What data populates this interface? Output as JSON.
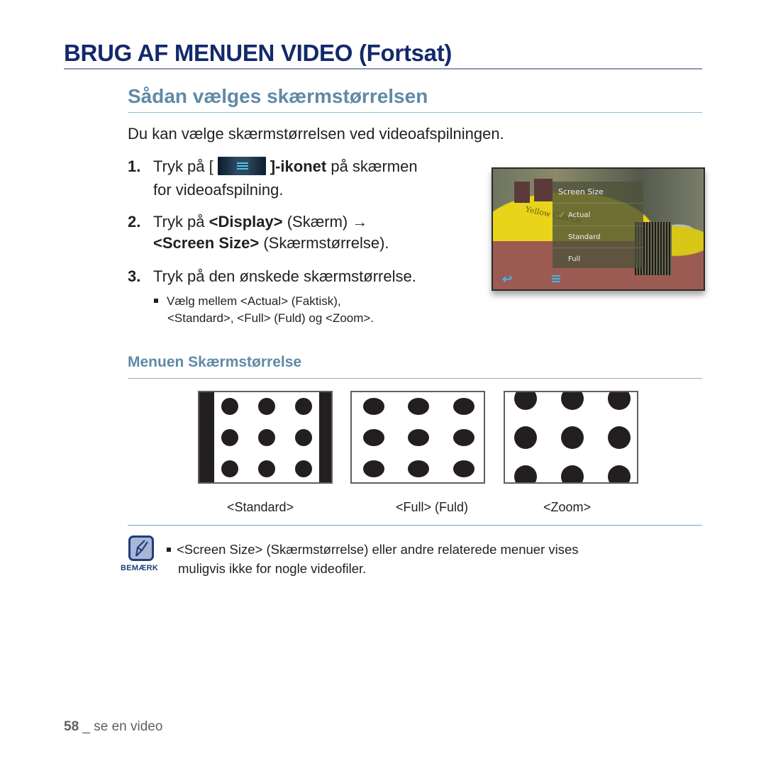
{
  "header": {
    "title": "BRUG AF MENUEN VIDEO (Fortsat)",
    "section_title": "Sådan vælges skærmstørrelsen"
  },
  "intro": "Du kan vælge skærmstørrelsen ved videoafspilningen.",
  "steps": [
    {
      "number": "1.",
      "prefix": "Tryk på [",
      "icon": "menu-icon",
      "bold_suffix": "]-ikonet",
      "rest": " på skærmen",
      "line2": "for videoafspilning."
    },
    {
      "number": "2.",
      "prefix": "Tryk på ",
      "bold1": "<Display>",
      "mid": " (Skærm) →",
      "bold2": "<Screen Size>",
      "rest": " (Skærmstørrelse)."
    },
    {
      "number": "3.",
      "text": "Tryk på den ønskede skærmstørrelse."
    }
  ],
  "step3_bullet": {
    "line1": "Vælg mellem <Actual> (Faktisk),",
    "line2": "<Standard>, <Full> (Fuld) og <Zoom>."
  },
  "device_screen": {
    "menu_title": "Screen Size",
    "options": [
      {
        "label": "Actual",
        "selected": true
      },
      {
        "label": "Standard",
        "selected": false
      },
      {
        "label": "Full",
        "selected": false
      }
    ],
    "taxi_text": "Yellow Cab Co.",
    "accent_color": "#3fb7e8",
    "check_color": "#7ed321"
  },
  "subsection": {
    "title": "Menuen Skærmstørrelse",
    "modes": [
      {
        "id": "standard",
        "label": "<Standard>"
      },
      {
        "id": "full",
        "label": "<Full> (Fuld)"
      },
      {
        "id": "zoom",
        "label": "<Zoom>"
      }
    ]
  },
  "note": {
    "label": "BEMÆRK",
    "line1": "<Screen Size> (Skærmstørrelse) eller andre relaterede menuer vises",
    "line2": "muligvis ikke for nogle videofiler."
  },
  "footer": {
    "page_number": "58",
    "separator": " _ ",
    "text": "se en video"
  }
}
